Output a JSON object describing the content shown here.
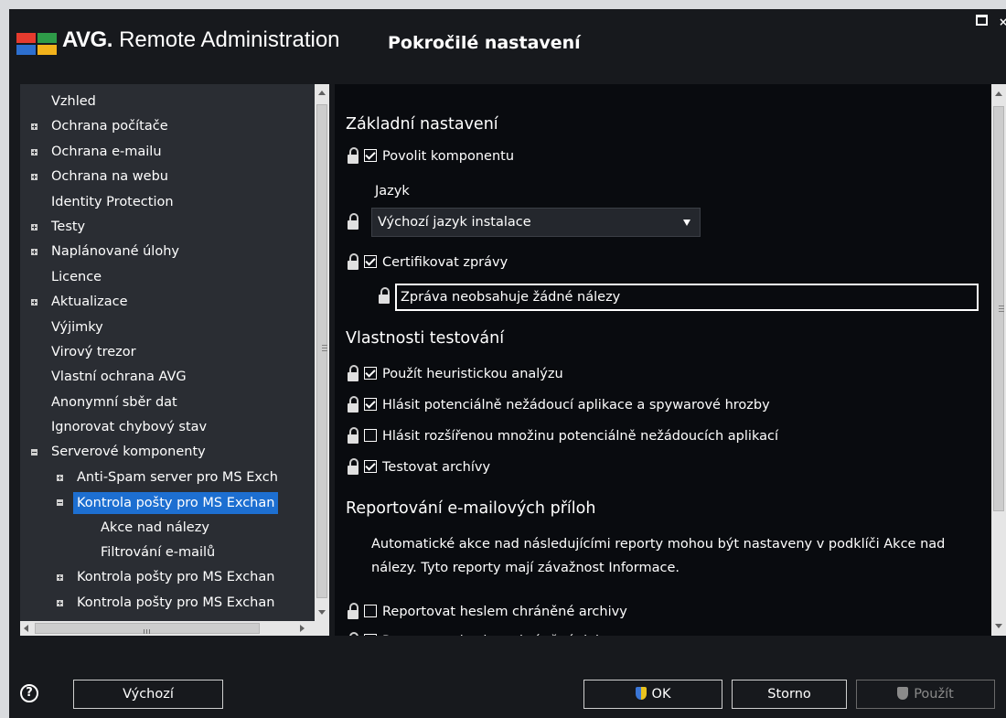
{
  "window": {
    "brand_bold": "AVG",
    "brand_rest": "Remote Administration",
    "page_title": "Pokročilé nastavení",
    "logo_colors": [
      "#e63b2e",
      "#2e9b48",
      "#2d6fcf",
      "#f2b21b"
    ]
  },
  "tree": {
    "items": [
      {
        "label": "Vzhled",
        "indent": 0,
        "expander": "none"
      },
      {
        "label": "Ochrana počítače",
        "indent": 0,
        "expander": "plus"
      },
      {
        "label": "Ochrana e-mailu",
        "indent": 0,
        "expander": "plus"
      },
      {
        "label": "Ochrana na webu",
        "indent": 0,
        "expander": "plus"
      },
      {
        "label": "Identity Protection",
        "indent": 0,
        "expander": "none"
      },
      {
        "label": "Testy",
        "indent": 0,
        "expander": "plus"
      },
      {
        "label": "Naplánované úlohy",
        "indent": 0,
        "expander": "plus"
      },
      {
        "label": "Licence",
        "indent": 0,
        "expander": "none"
      },
      {
        "label": "Aktualizace",
        "indent": 0,
        "expander": "plus"
      },
      {
        "label": "Výjimky",
        "indent": 0,
        "expander": "none"
      },
      {
        "label": "Virový trezor",
        "indent": 0,
        "expander": "none"
      },
      {
        "label": "Vlastní ochrana AVG",
        "indent": 0,
        "expander": "none"
      },
      {
        "label": "Anonymní sběr dat",
        "indent": 0,
        "expander": "none"
      },
      {
        "label": "Ignorovat chybový stav",
        "indent": 0,
        "expander": "none"
      },
      {
        "label": "Serverové komponenty",
        "indent": 0,
        "expander": "minus"
      },
      {
        "label": "Anti-Spam server pro MS Exch",
        "indent": 1,
        "expander": "plus"
      },
      {
        "label": "Kontrola pošty pro MS Exchan",
        "indent": 1,
        "expander": "minus",
        "selected": true
      },
      {
        "label": "Akce nad nálezy",
        "indent": 2,
        "expander": "none"
      },
      {
        "label": "Filtrování e-mailů",
        "indent": 2,
        "expander": "none"
      },
      {
        "label": "Kontrola pošty pro MS Exchan",
        "indent": 1,
        "expander": "plus"
      },
      {
        "label": "Kontrola pošty pro MS Exchan",
        "indent": 1,
        "expander": "plus"
      }
    ]
  },
  "content": {
    "section_basic": "Základní nastavení",
    "enable_component": {
      "label": "Povolit komponentu",
      "checked": true
    },
    "language_label": "Jazyk",
    "language_value": "Výchozí jazyk instalace",
    "certify": {
      "label": "Certifikovat zprávy",
      "checked": true
    },
    "certify_text": "Zpráva neobsahuje žádné nálezy",
    "section_scan": "Vlastnosti testování",
    "scan_options": [
      {
        "label": "Použít heuristickou analýzu",
        "checked": true
      },
      {
        "label": "Hlásit potenciálně nežádoucí aplikace a spywarové hrozby",
        "checked": true
      },
      {
        "label": "Hlásit rozšířenou množinu potenciálně nežádoucích aplikací",
        "checked": false
      },
      {
        "label": "Testovat archívy",
        "checked": true
      }
    ],
    "section_reporting": "Reportování e-mailových příloh",
    "reporting_text": "Automatické akce nad následujícími reporty mohou být nastaveny v podklíči Akce nad nálezy. Tyto reporty mají závažnost Informace.",
    "report_options": [
      {
        "label": "Reportovat heslem chráněné archivy",
        "checked": false
      },
      {
        "label": "Reportovat heslem chráněné dokumenty",
        "checked": false
      }
    ]
  },
  "footer": {
    "help": "?",
    "default_label": "Výchozí",
    "ok_label": "OK",
    "cancel_label": "Storno",
    "apply_label": "Použít"
  }
}
